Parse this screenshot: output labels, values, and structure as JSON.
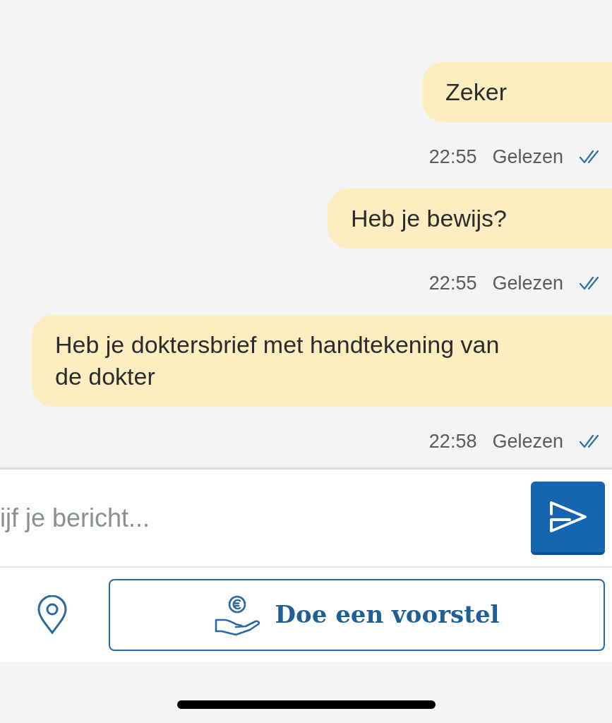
{
  "messages": [
    {
      "text": "Zeker",
      "time": "22:55",
      "status": "Gelezen",
      "read": true
    },
    {
      "text": "Heb je bewijs?",
      "time": "22:55",
      "status": "Gelezen",
      "read": true
    },
    {
      "text": "Heb je doktersbrief met handtekening van de dokter",
      "time": "22:58",
      "status": "Gelezen",
      "read": true
    }
  ],
  "composer": {
    "placeholder": "ijf je bericht..."
  },
  "offer_button": {
    "label": "Doe een voorstel"
  }
}
